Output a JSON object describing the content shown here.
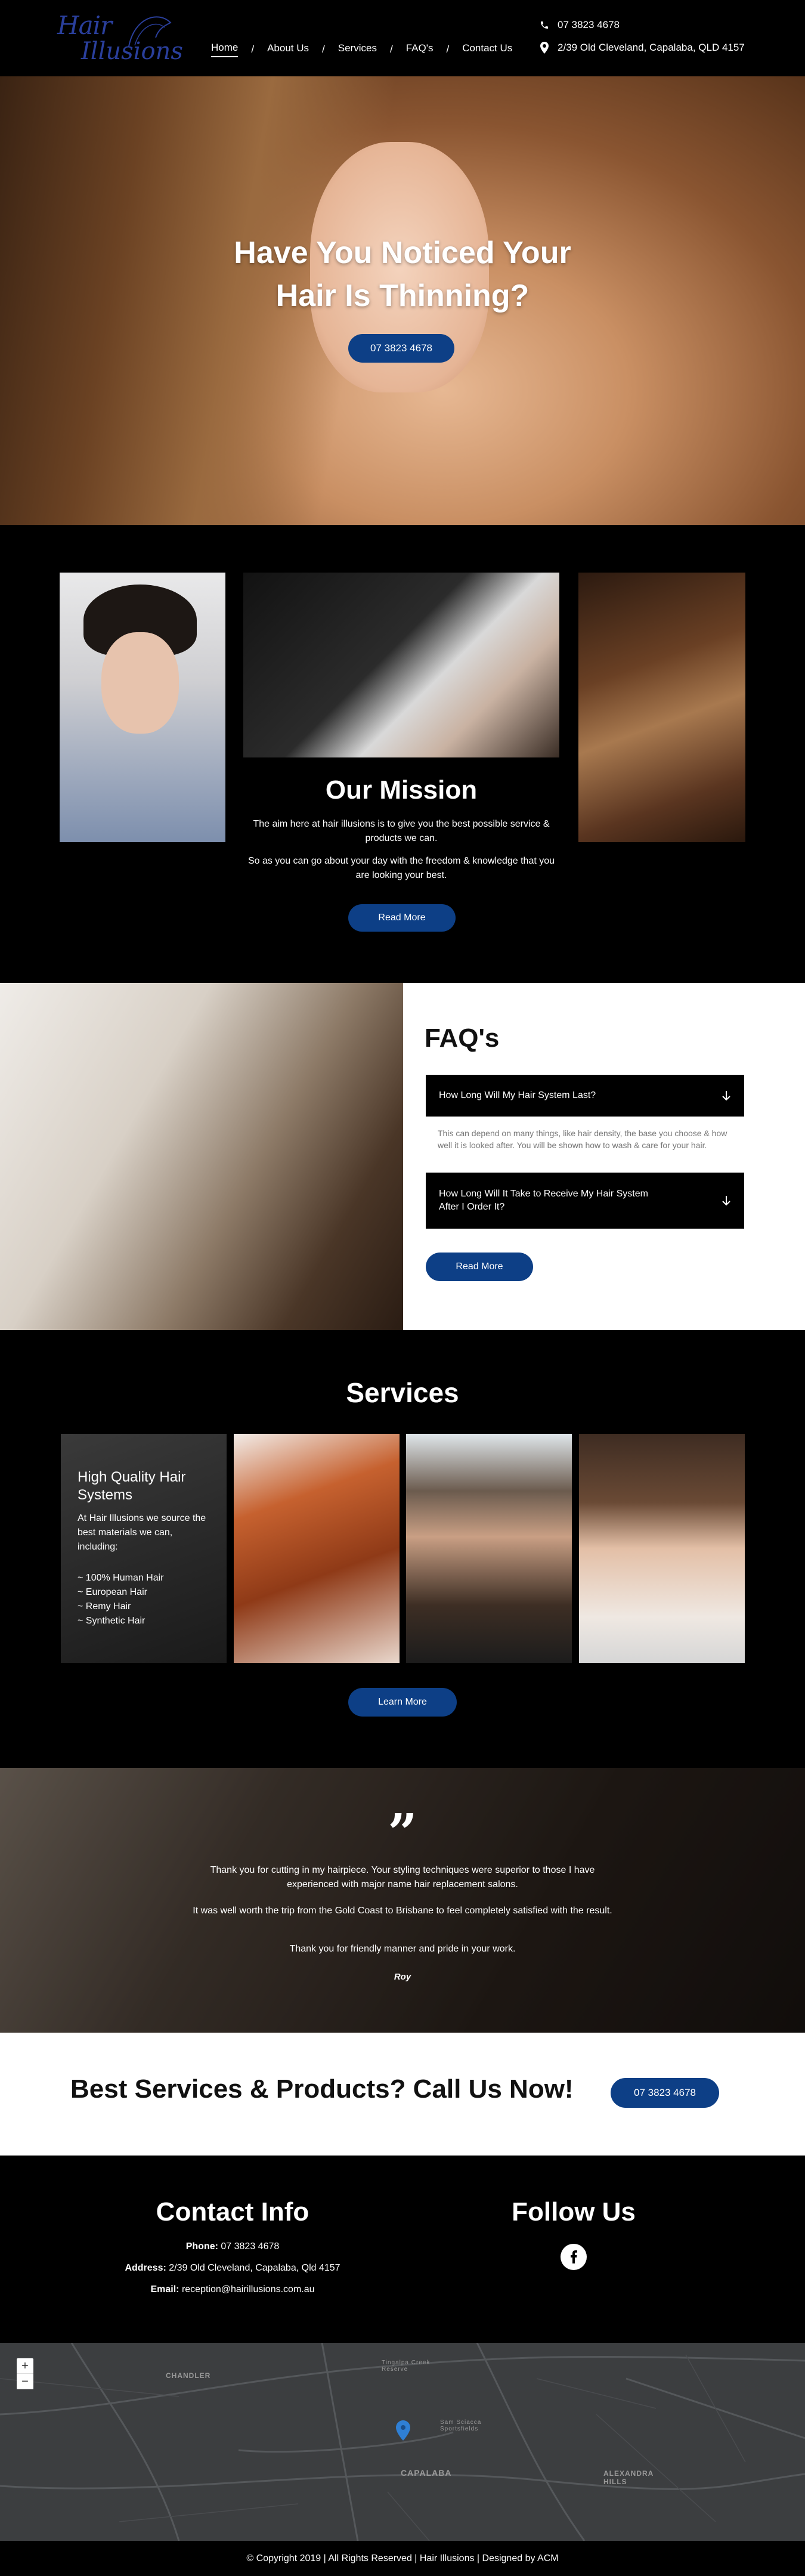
{
  "header": {
    "logo_line1": "Hair",
    "logo_line2": "Illusions",
    "nav": [
      {
        "label": "Home"
      },
      {
        "label": "About Us"
      },
      {
        "label": "Services"
      },
      {
        "label": "FAQ's"
      },
      {
        "label": "Contact Us"
      }
    ],
    "separator": "/",
    "phone": "07 3823 4678",
    "address": "2/39 Old Cleveland, Capalaba, QLD 4157"
  },
  "hero": {
    "title_line1": "Have You Noticed Your",
    "title_line2": "Hair Is Thinning?",
    "button": "07 3823 4678"
  },
  "mission": {
    "title": "Our Mission",
    "text1": "The aim here at hair illusions is to give you the best possible service & products we can.",
    "text2": "So as you can go about your day with the freedom & knowledge that you are looking your best.",
    "button": "Read More"
  },
  "faq": {
    "title": "FAQ's",
    "items": [
      {
        "question": "How Long Will My Hair System Last?",
        "answer": "This can depend on many things, like hair density, the base you choose & how well it is looked after. You will be shown how to wash & care for your hair."
      },
      {
        "question": "How Long Will It Take to Receive My Hair System After I Order It?"
      }
    ],
    "button": "Read More"
  },
  "services": {
    "title": "Services",
    "card_title": "High Quality Hair Systems",
    "card_text": "At Hair Illusions we source the best materials we can, including:",
    "list": [
      "~ 100% Human Hair",
      "~ European Hair",
      "~ Remy Hair",
      "~ Synthetic Hair"
    ],
    "button": "Learn More"
  },
  "testimonial": {
    "quote_mark": "”",
    "p1": "Thank you for cutting in my hairpiece.  Your styling techniques were superior to those I have experienced with major name hair replacement salons.",
    "p2": "It was well worth the trip from the Gold Coast to Brisbane to feel completely satisfied with the result.",
    "p3": "Thank you for friendly manner and pride in your work.",
    "author": "Roy"
  },
  "cta": {
    "title": "Best Services & Products? Call Us Now!",
    "button": "07 3823 4678"
  },
  "contact": {
    "title": "Contact Info",
    "phone_label": "Phone:",
    "phone": "07 3823 4678",
    "address_label": "Address:",
    "address": "2/39 Old Cleveland, Capalaba, Qld 4157",
    "email_label": "Email:",
    "email": "reception@hairillusions.com.au",
    "follow_title": "Follow Us"
  },
  "map": {
    "zoom_in": "+",
    "zoom_out": "−",
    "labels": [
      "CHANDLER",
      "CAPALABA",
      "ALEXANDRA HILLS",
      "Tingalpa Creek Reserve",
      "Sam Sciacca Sportsfields"
    ]
  },
  "footer": {
    "text": "© Copyright 2019 | All Rights Reserved | Hair Illusions | Designed by ACM"
  },
  "colors": {
    "accent": "#0d3f86",
    "logo": "#2a3f9c"
  }
}
